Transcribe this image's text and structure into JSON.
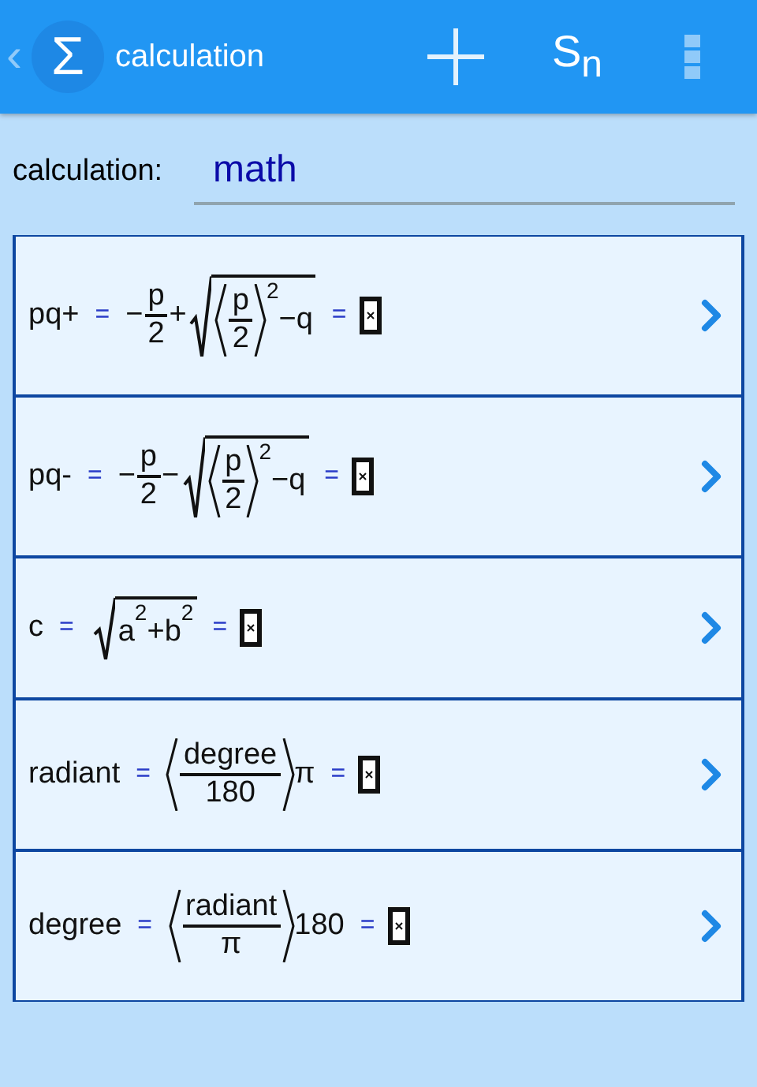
{
  "app_bar": {
    "back": "‹",
    "logo": "Σ",
    "title": "calculation",
    "sum_button": "S$_{n}$"
  },
  "field": {
    "label": "calculation:",
    "value": "math"
  },
  "rows": [
    {
      "name": "pq+",
      "equals": "=",
      "formula": [
        {
          "kind": "text",
          "text": "−"
        },
        {
          "kind": "frac",
          "num": [
            {
              "kind": "text",
              "text": "p"
            }
          ],
          "den": [
            {
              "kind": "text",
              "text": "2"
            }
          ]
        },
        {
          "kind": "text",
          "text": "+"
        },
        {
          "kind": "sqrt",
          "children": [
            {
              "kind": "paren",
              "children": [
                {
                  "kind": "frac",
                  "num": [
                    {
                      "kind": "text",
                      "text": "p"
                    }
                  ],
                  "den": [
                    {
                      "kind": "text",
                      "text": "2"
                    }
                  ]
                }
              ]
            },
            {
              "kind": "sup",
              "text": "2"
            },
            {
              "kind": "text",
              "text": "−q"
            }
          ]
        }
      ],
      "result_equals": "="
    },
    {
      "name": "pq-",
      "equals": "=",
      "formula": [
        {
          "kind": "text",
          "text": "−"
        },
        {
          "kind": "frac",
          "num": [
            {
              "kind": "text",
              "text": "p"
            }
          ],
          "den": [
            {
              "kind": "text",
              "text": "2"
            }
          ]
        },
        {
          "kind": "text",
          "text": "−"
        },
        {
          "kind": "sqrt",
          "children": [
            {
              "kind": "paren",
              "children": [
                {
                  "kind": "frac",
                  "num": [
                    {
                      "kind": "text",
                      "text": "p"
                    }
                  ],
                  "den": [
                    {
                      "kind": "text",
                      "text": "2"
                    }
                  ]
                }
              ]
            },
            {
              "kind": "sup",
              "text": "2"
            },
            {
              "kind": "text",
              "text": "−q"
            }
          ]
        }
      ],
      "result_equals": "="
    },
    {
      "name": "c",
      "equals": "=",
      "formula": [
        {
          "kind": "sqrt",
          "children": [
            {
              "kind": "text",
              "text": "a"
            },
            {
              "kind": "sup",
              "text": "2"
            },
            {
              "kind": "text",
              "text": "+b"
            },
            {
              "kind": "sup",
              "text": "2"
            }
          ]
        }
      ],
      "result_equals": "="
    },
    {
      "name": "radiant",
      "equals": "=",
      "formula": [
        {
          "kind": "paren",
          "children": [
            {
              "kind": "frac",
              "num": [
                {
                  "kind": "text",
                  "text": "degree"
                }
              ],
              "den": [
                {
                  "kind": "text",
                  "text": "180"
                }
              ]
            }
          ]
        },
        {
          "kind": "text",
          "text": "π"
        }
      ],
      "result_equals": "="
    },
    {
      "name": "degree",
      "equals": "=",
      "formula": [
        {
          "kind": "paren",
          "children": [
            {
              "kind": "frac",
              "num": [
                {
                  "kind": "text",
                  "text": "radiant"
                }
              ],
              "den": [
                {
                  "kind": "text",
                  "text": "π"
                }
              ]
            }
          ]
        },
        {
          "kind": "text",
          "text": "180"
        }
      ],
      "result_equals": "="
    }
  ]
}
